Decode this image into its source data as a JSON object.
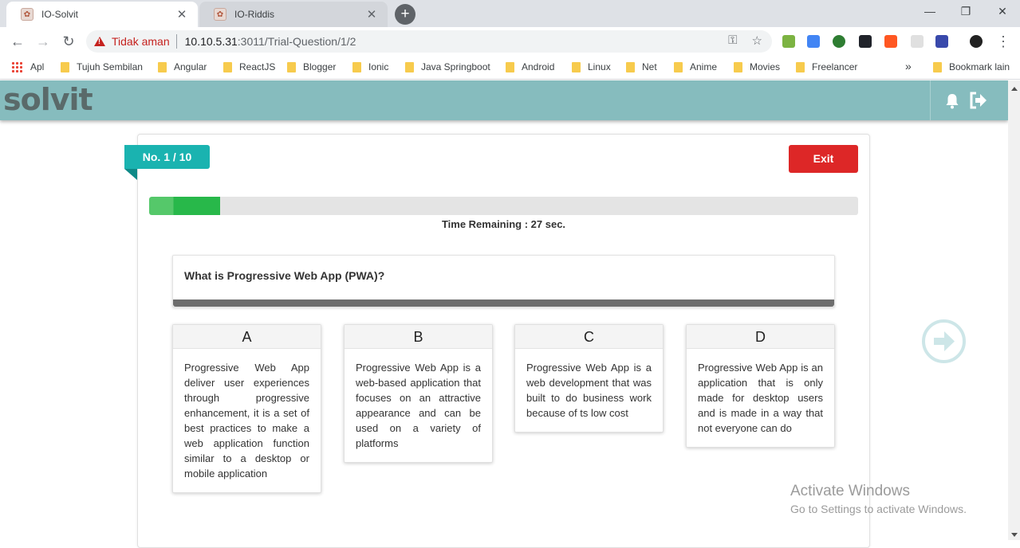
{
  "browser": {
    "tabs": [
      {
        "title": "IO-Solvit",
        "active": true
      },
      {
        "title": "IO-Riddis",
        "active": false
      }
    ],
    "address": {
      "security_label": "Tidak aman",
      "host": "10.10.5.31",
      "path": ":3011/Trial-Question/1/2"
    },
    "bookmarks": [
      "Apl",
      "Tujuh Sembilan",
      "Angular",
      "ReactJS",
      "Blogger",
      "Ionic",
      "Java Springboot",
      "Android",
      "Linux",
      "Net",
      "Anime",
      "Movies",
      "Freelancer"
    ],
    "bookmarks_other": "Bookmark lain",
    "bookmarks_overflow": "»"
  },
  "app": {
    "logo": "solvit",
    "colors": {
      "header": "#86bcbe",
      "accent": "#1ab3b0",
      "exit": "#dd2727",
      "progress": "#28b84a"
    }
  },
  "quiz": {
    "number_label": "No. 1 / 10",
    "exit_label": "Exit",
    "time_progress": 0.1,
    "time_label": "Time Remaining : 27 sec.",
    "question": "What is Progressive Web App (PWA)?",
    "options": [
      {
        "letter": "A",
        "text": "Progressive Web App deliver user experiences through progressive enhancement, it is a set of best practices to make a web application function similar to a desktop or mobile application"
      },
      {
        "letter": "B",
        "text": "Progressive Web App is a web-based application that focuses on an attractive appearance and can be used on a variety of platforms"
      },
      {
        "letter": "C",
        "text": "Progressive Web App is a web development that was built to do business work because of ts low cost"
      },
      {
        "letter": "D",
        "text": "Progressive Web App is an application that is only made for desktop users and is made in a way that not everyone can do"
      }
    ]
  },
  "os": {
    "watermark_title": "Activate Windows",
    "watermark_sub": "Go to Settings to activate Windows."
  }
}
